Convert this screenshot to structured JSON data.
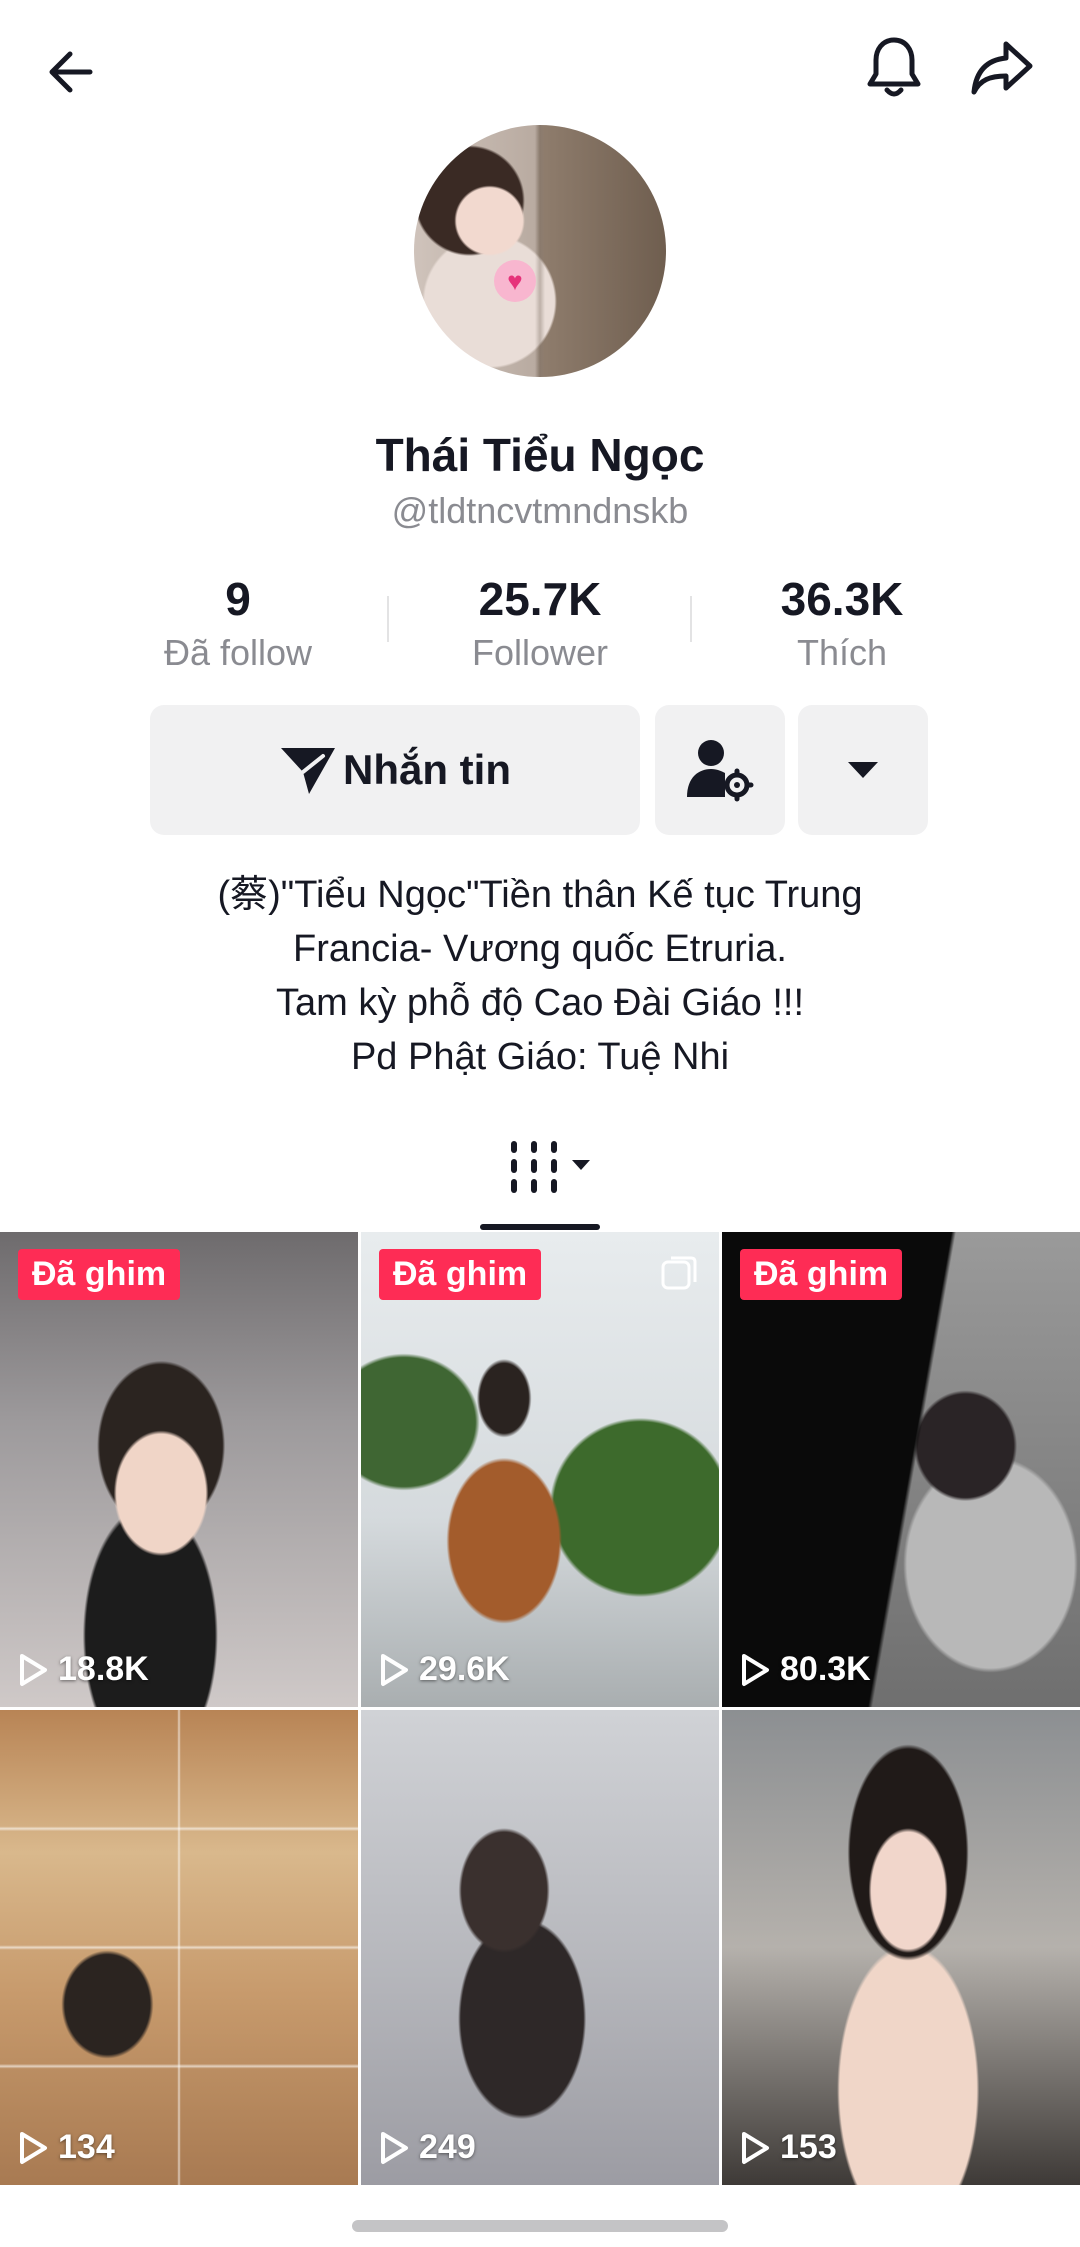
{
  "profile": {
    "name": "Thái Tiểu Ngọc",
    "handle": "@tldtncvtmndnskb"
  },
  "stats": [
    {
      "value": "9",
      "label": "Đã follow"
    },
    {
      "value": "25.7K",
      "label": "Follower"
    },
    {
      "value": "36.3K",
      "label": "Thích"
    }
  ],
  "actions": {
    "message_label": "Nhắn tin"
  },
  "bio": [
    "(蔡)\"Tiểu Ngọc\"Tiền thân Kế tục Trung",
    "Francia- Vương quốc Etruria.",
    "Tam kỳ phỗ độ Cao Đài Giáo !!!",
    "Pd Phật Giáo: Tuệ Nhi"
  ],
  "videos": [
    {
      "pinned_label": "Đã ghim",
      "views": "18.8K"
    },
    {
      "pinned_label": "Đã ghim",
      "views": "29.6K"
    },
    {
      "pinned_label": "Đã ghim",
      "views": "80.3K"
    },
    {
      "views": "134"
    },
    {
      "views": "249"
    },
    {
      "views": "153"
    }
  ],
  "icons": {
    "back": "back-arrow-icon",
    "bell": "bell-icon",
    "share": "share-icon",
    "message": "send-icon",
    "friend": "user-settings-icon",
    "more": "caret-down-icon",
    "grid": "grid-icon",
    "play": "play-icon"
  },
  "colors": {
    "accent": "#fe2c55",
    "text": "#161823",
    "muted": "#8a8b91",
    "button_bg": "#f1f1f2"
  }
}
